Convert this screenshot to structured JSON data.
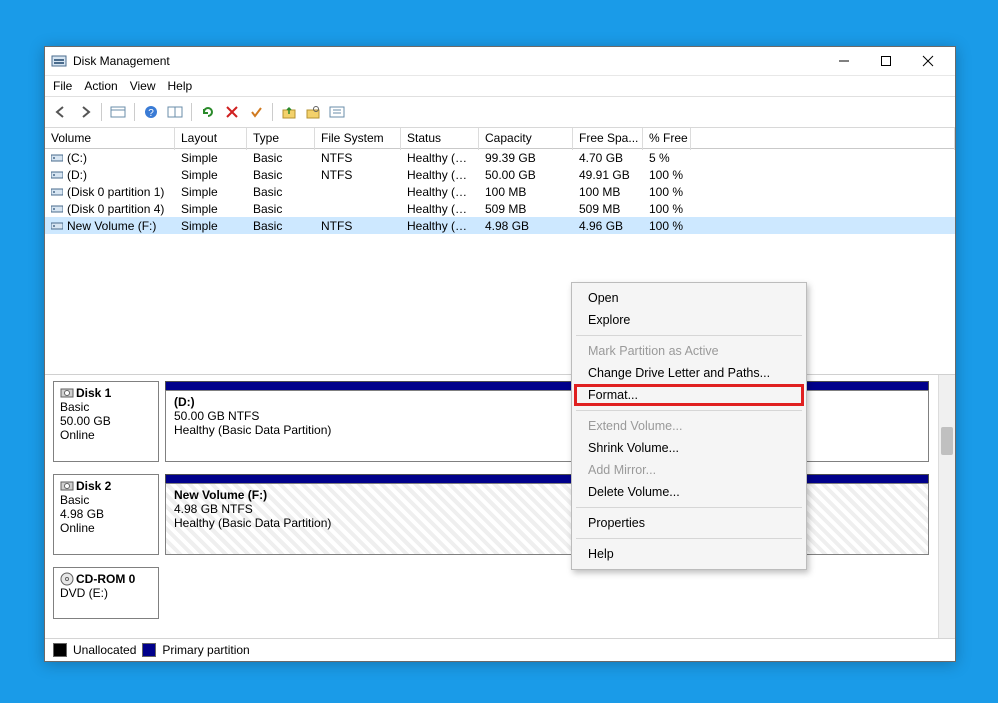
{
  "window": {
    "title": "Disk Management"
  },
  "menu": {
    "items": [
      "File",
      "Action",
      "View",
      "Help"
    ]
  },
  "volumes": {
    "columns": [
      "Volume",
      "Layout",
      "Type",
      "File System",
      "Status",
      "Capacity",
      "Free Spa...",
      "% Free"
    ],
    "rows": [
      {
        "name": "(C:)",
        "layout": "Simple",
        "type": "Basic",
        "fs": "NTFS",
        "status": "Healthy (B...",
        "capacity": "99.39 GB",
        "free": "4.70 GB",
        "pct": "5 %"
      },
      {
        "name": "(D:)",
        "layout": "Simple",
        "type": "Basic",
        "fs": "NTFS",
        "status": "Healthy (B...",
        "capacity": "50.00 GB",
        "free": "49.91 GB",
        "pct": "100 %"
      },
      {
        "name": "(Disk 0 partition 1)",
        "layout": "Simple",
        "type": "Basic",
        "fs": "",
        "status": "Healthy (E...",
        "capacity": "100 MB",
        "free": "100 MB",
        "pct": "100 %"
      },
      {
        "name": "(Disk 0 partition 4)",
        "layout": "Simple",
        "type": "Basic",
        "fs": "",
        "status": "Healthy (R...",
        "capacity": "509 MB",
        "free": "509 MB",
        "pct": "100 %"
      },
      {
        "name": "New Volume (F:)",
        "layout": "Simple",
        "type": "Basic",
        "fs": "NTFS",
        "status": "Healthy (B...",
        "capacity": "4.98 GB",
        "free": "4.96 GB",
        "pct": "100 %",
        "selected": true
      }
    ]
  },
  "disks": [
    {
      "label": "Disk 1",
      "type": "Basic",
      "size": "50.00 GB",
      "state": "Online",
      "partitions": [
        {
          "name": "(D:)",
          "detail1": "50.00 GB NTFS",
          "detail2": "Healthy (Basic Data Partition)",
          "hatched": false
        }
      ]
    },
    {
      "label": "Disk 2",
      "type": "Basic",
      "size": "4.98 GB",
      "state": "Online",
      "partitions": [
        {
          "name": "New Volume  (F:)",
          "detail1": "4.98 GB NTFS",
          "detail2": "Healthy (Basic Data Partition)",
          "hatched": true
        }
      ]
    },
    {
      "label": "CD-ROM 0",
      "type": "DVD (E:)",
      "size": "",
      "state": "",
      "partitions": []
    }
  ],
  "legend": {
    "unallocated": {
      "label": "Unallocated",
      "color": "#000000"
    },
    "primary": {
      "label": "Primary partition",
      "color": "#00008b"
    }
  },
  "context_menu": {
    "groups": [
      [
        {
          "label": "Open",
          "enabled": true
        },
        {
          "label": "Explore",
          "enabled": true
        }
      ],
      [
        {
          "label": "Mark Partition as Active",
          "enabled": false
        },
        {
          "label": "Change Drive Letter and Paths...",
          "enabled": true
        },
        {
          "label": "Format...",
          "enabled": true,
          "highlight": true
        }
      ],
      [
        {
          "label": "Extend Volume...",
          "enabled": false
        },
        {
          "label": "Shrink Volume...",
          "enabled": true
        },
        {
          "label": "Add Mirror...",
          "enabled": false
        },
        {
          "label": "Delete Volume...",
          "enabled": true
        }
      ],
      [
        {
          "label": "Properties",
          "enabled": true
        }
      ],
      [
        {
          "label": "Help",
          "enabled": true
        }
      ]
    ]
  }
}
